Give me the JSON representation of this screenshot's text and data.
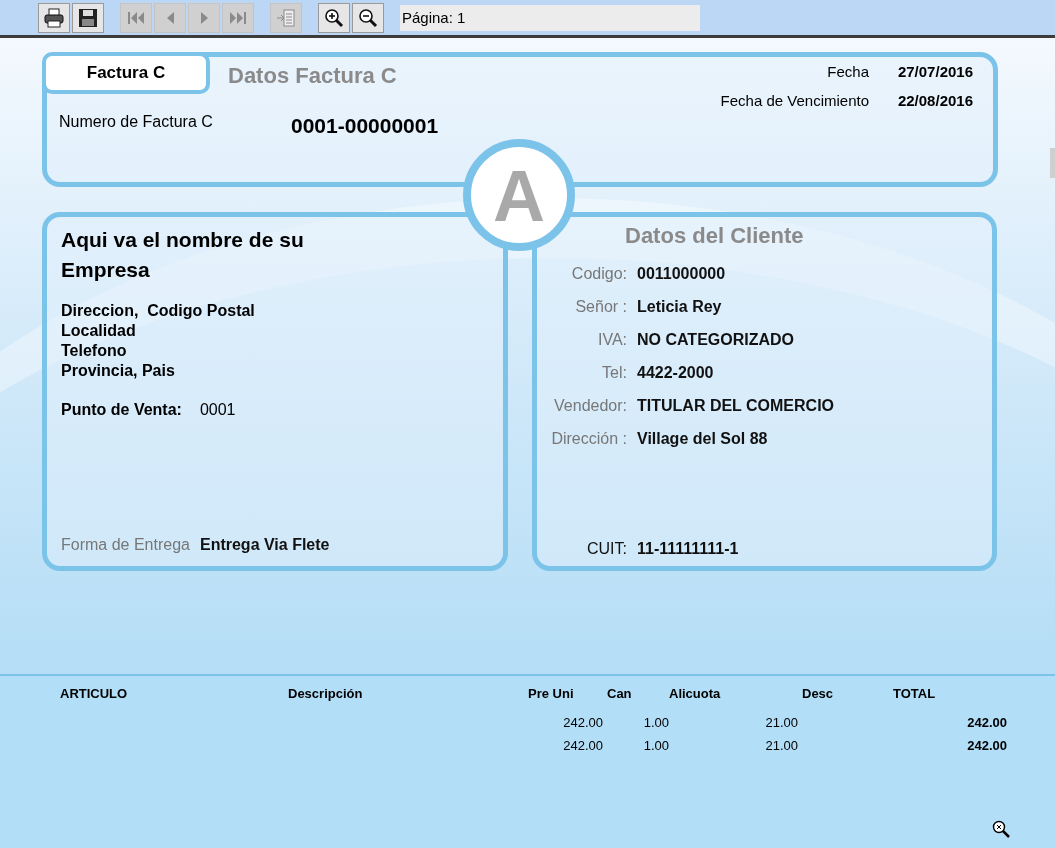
{
  "toolbar": {
    "buttons": [
      {
        "kind": "print",
        "disabled": false
      },
      {
        "kind": "save",
        "disabled": false
      },
      {
        "kind": "first",
        "disabled": true
      },
      {
        "kind": "prev",
        "disabled": true
      },
      {
        "kind": "next",
        "disabled": true
      },
      {
        "kind": "last",
        "disabled": true
      },
      {
        "kind": "export",
        "disabled": true
      },
      {
        "kind": "zoom-in",
        "disabled": false
      },
      {
        "kind": "zoom-out",
        "disabled": false
      }
    ],
    "page_field": "Página: 1"
  },
  "invoice": {
    "tab": "Factura C",
    "title": "Datos Factura C",
    "number_label": "Numero de Factura C",
    "number": "0001-00000001",
    "dates": [
      {
        "label": "Fecha",
        "value": "27/07/2016"
      },
      {
        "label": "Fecha de Vencimiento",
        "value": "22/08/2016"
      }
    ],
    "letter": "A"
  },
  "company": {
    "name": "Aqui va el nombre de su Empresa",
    "address_lines": [
      "Direccion,  Codigo Postal",
      "Localidad",
      "Telefono",
      "Provincia, Pais"
    ],
    "point_of_sale_label": "Punto de Venta:",
    "point_of_sale": "0001",
    "delivery_label": "Forma de Entrega",
    "delivery": "Entrega Via Flete"
  },
  "client": {
    "title": "Datos del Cliente",
    "fields": [
      {
        "label": "Codigo:",
        "value": "0011000000"
      },
      {
        "label": "Señor :",
        "value": "Leticia Rey"
      },
      {
        "label": "IVA:",
        "value": "NO CATEGORIZADO"
      },
      {
        "label": "Tel:",
        "value": "4422-2000"
      },
      {
        "label": "Vendedor:",
        "value": "TITULAR DEL COMERCIO"
      },
      {
        "label": "Dirección :",
        "value": "Village del Sol 88"
      }
    ],
    "cuit_label": "CUIT:",
    "cuit": "11-11111111-1"
  },
  "table": {
    "columns": [
      "ARTICULO",
      "Descripción",
      "Pre Uni",
      "Can",
      "Alicuota",
      "Desc",
      "TOTAL"
    ],
    "rows": [
      {
        "pre_uni": "242.00",
        "can": "1.00",
        "alicuota": "21.00",
        "total": "242.00"
      },
      {
        "pre_uni": "242.00",
        "can": "1.00",
        "alicuota": "21.00",
        "total": "242.00"
      }
    ]
  }
}
